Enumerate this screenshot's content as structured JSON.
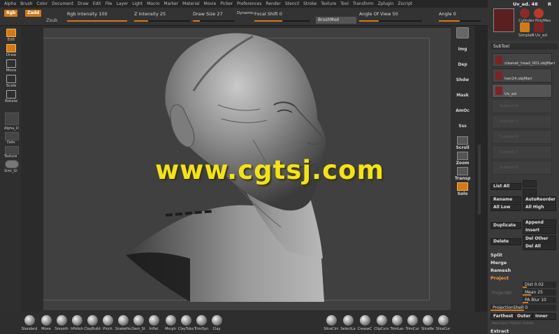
{
  "menu": [
    "Alpha",
    "Brush",
    "Color",
    "Document",
    "Draw",
    "Edit",
    "File",
    "Layer",
    "Light",
    "Macro",
    "Marker",
    "Material",
    "Movie",
    "Picker",
    "Preferences",
    "Render",
    "Stencil",
    "Stroke",
    "Texture",
    "Tool",
    "Transform",
    "Zplugin",
    "Zscript"
  ],
  "topbar": {
    "rgb": "Rgb",
    "zadd": "Zadd",
    "zsub": "Zsub",
    "rgb_intensity": "Rgb Intensity 100",
    "z_intensity": "Z Intensity 25",
    "draw_size": "Draw Size 27",
    "dynamic": "Dynamic",
    "focal_shift": "Focal Shift 0",
    "brushmod": "BrushMod",
    "angle_of_view": "Angle Of View 50",
    "angle": "Angle 0"
  },
  "left_tools": [
    "Edit",
    "Draw",
    "Move",
    "Scale",
    "Rotate"
  ],
  "left_boxes": [
    "Alpha_O",
    "Dots",
    "Texture",
    "Simi_Gi"
  ],
  "right_tools": [
    "Persp",
    "Floor",
    "Local",
    "Sculpt",
    "Scroll",
    "Zoom",
    "Rotate",
    "Transp",
    "Ghost",
    "Solo"
  ],
  "right_labels": {
    "persp": "Img",
    "floor": "Dep",
    "local": "Shdw",
    "mask": "Mask",
    "amoc": "AmOc",
    "sss": "Sss",
    "scroll": "Scroll",
    "zoom": "Zoom",
    "transp": "Transp",
    "solo": "Solo"
  },
  "watermark": "www.cgtsj.com",
  "tool_panel": {
    "name": "Uv_ed. 48",
    "r_label": "R",
    "cylinder": "Cylinder",
    "polymesh": "PolyMes",
    "simple": "SimpleB",
    "uved": "Uv_ed"
  },
  "subtool": {
    "header": "SubTool",
    "items": [
      "cleanet_head_001.objMari",
      "hen24.objMari",
      "Uv_ed"
    ],
    "empty": [
      "Subtool 4",
      "Subtool 5",
      "Subtool 6",
      "Subtool 7",
      "Subtool 8"
    ]
  },
  "panel_buttons": {
    "list_all": "List All",
    "rename": "Rename",
    "autoreorder": "AutoReorder",
    "all_low": "All Low",
    "all_high": "All High",
    "duplicate": "Duplicate",
    "append": "Append",
    "insert": "Insert",
    "delete": "Delete",
    "del_other": "Del Other",
    "del_all": "Del All",
    "split": "Split",
    "merge": "Merge",
    "remesh": "Remesh",
    "project": "Project",
    "project_all": "ProjectAll",
    "dist": "Dist 0.02",
    "mean": "Mean 25",
    "pa_blur": "PA Blur 10",
    "projection_shell": "ProjectionShell 0",
    "farthest": "Farthest",
    "outer": "Outer",
    "inner": "Inner",
    "reproject": "Reproject Higher Subdiv",
    "extract": "Extract"
  },
  "brushes": [
    "Standard",
    "Move",
    "Smooth",
    "hPolish",
    "ClayBuild",
    "Pinch",
    "SnakeHo",
    "Dam_St",
    "Inflat",
    "Morph",
    "ClayTubs",
    "TrimDyn",
    "Clay"
  ],
  "brushes_right": [
    "SliceCirc",
    "SelectLa",
    "CreaseC",
    "ClipCurv",
    "TrimLas",
    "TrimCur",
    "SliceRe",
    "SliceCur"
  ],
  "colors": {
    "accent": "#d07a1a",
    "watermark": "#f2e21b"
  }
}
